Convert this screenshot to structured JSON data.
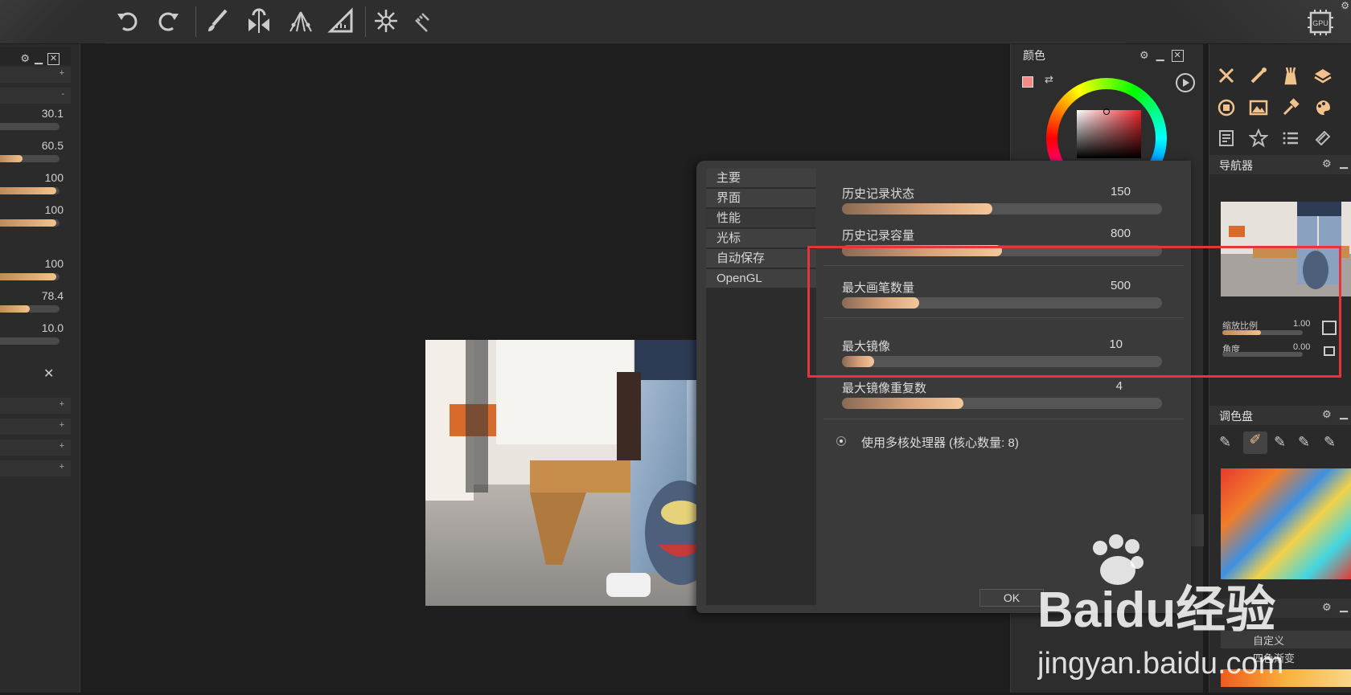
{
  "left_panel": {
    "values": [
      "30.1",
      "60.5",
      "100",
      "100",
      "100",
      "78.4",
      "10.0"
    ],
    "fills": [
      0.0,
      0.38,
      0.95,
      0.95,
      0.95,
      0.5,
      0.0
    ]
  },
  "color_panel": {
    "title": "颜色"
  },
  "navigator": {
    "title": "导航器",
    "zoom_label": "缩放比例",
    "zoom_value": "1.00",
    "angle_label": "角度",
    "angle_value": "0.00"
  },
  "palette": {
    "title": "调色盘"
  },
  "gradient": {
    "items": [
      "自定义",
      "四色渐变"
    ]
  },
  "dialog": {
    "nav": [
      "主要",
      "界面",
      "性能",
      "光标",
      "自动保存",
      "OpenGL"
    ],
    "settings": [
      {
        "label": "历史记录状态",
        "value": "150",
        "fill": 0.47
      },
      {
        "label": "历史记录容量",
        "value": "800",
        "fill": 0.5
      },
      {
        "label": "最大画笔数量",
        "value": "500",
        "fill": 0.24
      },
      {
        "label": "最大镜像",
        "value": "10",
        "fill": 0.1
      },
      {
        "label": "最大镜像重复数",
        "value": "4",
        "fill": 0.38
      }
    ],
    "multicore_label": "使用多核处理器 (核心数量: 8)",
    "ok_label": "OK"
  },
  "toolbar": {
    "gpu_label": "GPU"
  },
  "watermark": {
    "brand": "Baidu经验",
    "url": "jingyan.baidu.com"
  },
  "colors": {
    "accent": "#f2c28c",
    "highlight": "#e8333a"
  }
}
